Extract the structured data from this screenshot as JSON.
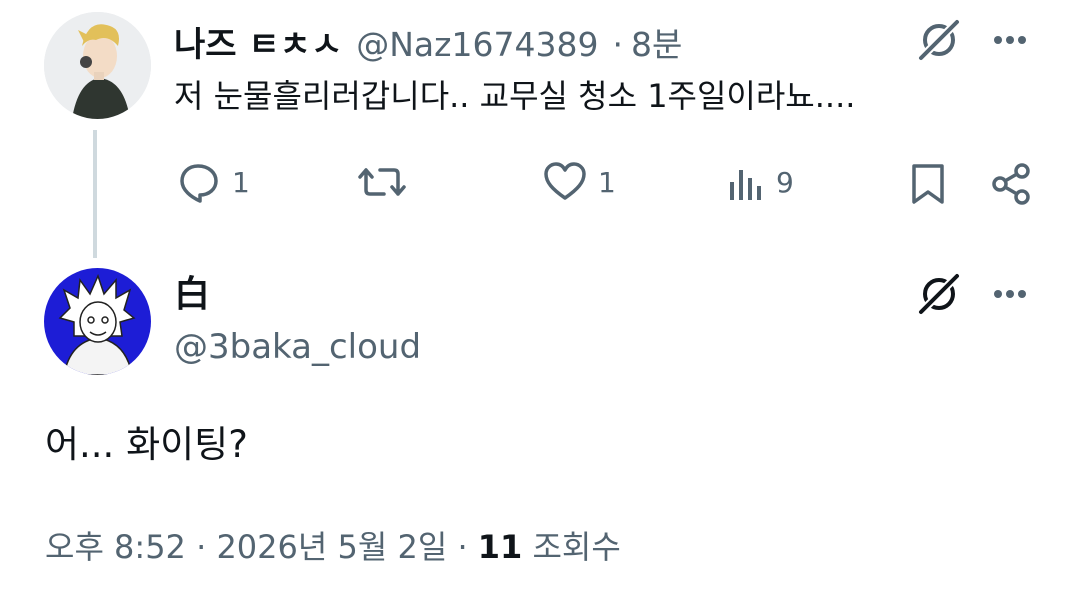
{
  "reply_tweet": {
    "display_name": "나즈 ㅌㅊㅅ",
    "handle": "@Naz1674389",
    "separator": "·",
    "time": "8분",
    "text": "저 눈물흘리러갑니다.. 교무실 청소 1주일이라뇨....",
    "actions": {
      "reply_count": "1",
      "retweet_count": "",
      "like_count": "1",
      "view_count": "9"
    },
    "icons": [
      "grok-icon",
      "more-icon",
      "reply-icon",
      "retweet-icon",
      "like-icon",
      "views-icon",
      "bookmark-icon",
      "share-icon"
    ]
  },
  "main_tweet": {
    "display_name": "白",
    "handle": "@3baka_cloud",
    "text": "어... 화이팅?",
    "time": "오후 8:52",
    "sep1": "·",
    "date": "2026년 5월 2일",
    "sep2": "·",
    "views_count": "11",
    "views_label": "조회수",
    "icons": [
      "grok-icon",
      "more-icon"
    ]
  },
  "colors": {
    "text": "#0f1419",
    "muted": "#536471",
    "thread_line": "#cfd9de",
    "avatar2_bg": "#1d1dd6"
  }
}
